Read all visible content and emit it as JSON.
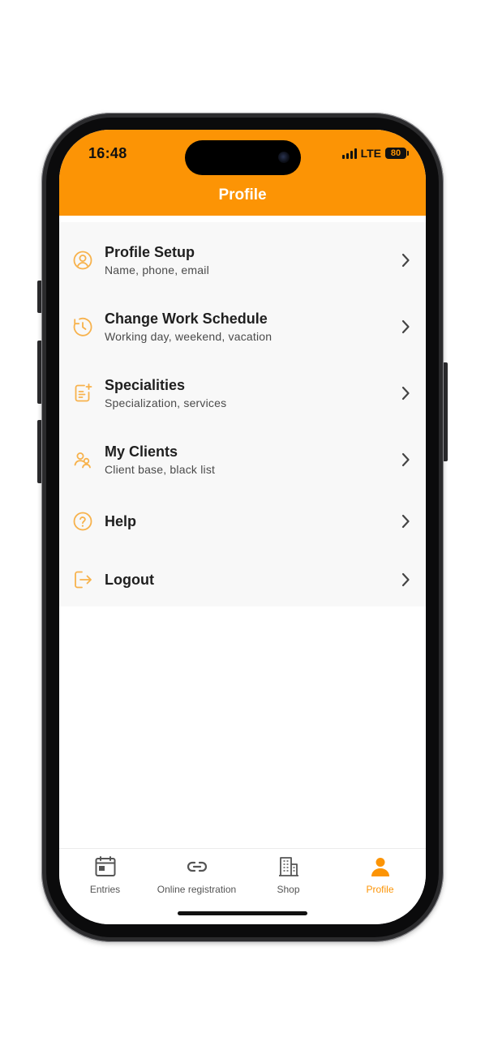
{
  "status_bar": {
    "time": "16:48",
    "network": "LTE",
    "battery": "80"
  },
  "header": {
    "title": "Profile"
  },
  "menu": {
    "items": [
      {
        "icon": "user-circle-icon",
        "title": "Profile Setup",
        "subtitle": "Name, phone, email"
      },
      {
        "icon": "clock-schedule-icon",
        "title": "Change Work Schedule",
        "subtitle": "Working day, weekend, vacation"
      },
      {
        "icon": "document-add-icon",
        "title": "Specialities",
        "subtitle": "Specialization, services"
      },
      {
        "icon": "users-icon",
        "title": "My Clients",
        "subtitle": "Client base, black list"
      },
      {
        "icon": "help-circle-icon",
        "title": "Help"
      },
      {
        "icon": "logout-icon",
        "title": "Logout"
      }
    ]
  },
  "tabbar": {
    "items": [
      {
        "icon": "calendar-icon",
        "label": "Entries"
      },
      {
        "icon": "link-icon",
        "label": "Online registration"
      },
      {
        "icon": "building-icon",
        "label": "Shop"
      },
      {
        "icon": "person-icon",
        "label": "Profile",
        "active": true
      }
    ]
  },
  "colors": {
    "accent": "#fc9405",
    "icon_light": "#f7b24c",
    "text_primary": "#1f1f1f",
    "text_secondary": "#4a4a4a"
  }
}
